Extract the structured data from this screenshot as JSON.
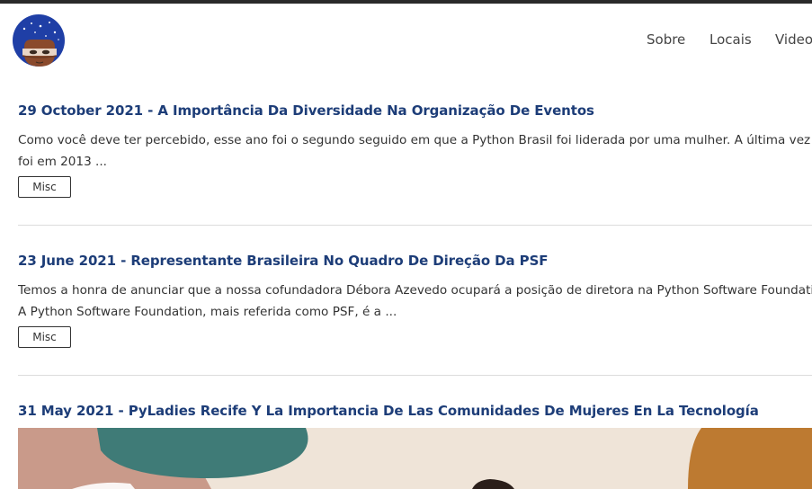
{
  "nav": {
    "items": [
      {
        "label": "Sobre"
      },
      {
        "label": "Locais"
      },
      {
        "label": "Videos"
      }
    ]
  },
  "posts": [
    {
      "date": "29 October 2021",
      "title": "A Importância Da Diversidade Na Organização De Eventos",
      "excerpt_line1": "Como você deve ter percebido, esse ano foi o segundo seguido em que a Python Brasil foi liderada por uma mulher. A última vez",
      "excerpt_line2": "foi em 2013 ...",
      "tag": "Misc"
    },
    {
      "date": "23 June 2021",
      "title": "Representante Brasileira No Quadro De Direção Da PSF",
      "excerpt_line1": "Temos a honra de anunciar que a nossa cofundadora Débora Azevedo ocupará a posição de diretora na Python Software Foundation.",
      "excerpt_line2": "A Python Software Foundation, mais referida como PSF, é a ...",
      "tag": "Misc"
    },
    {
      "date": "31 May 2021",
      "title": "PyLadies Recife Y La Importancia De Las Comunidades De Mujeres En La Tecnología"
    }
  ],
  "title_separator": " - ",
  "colors": {
    "title": "#1d3d78",
    "top_bar": "#2a2a2a",
    "divider": "#dcdcdc"
  }
}
